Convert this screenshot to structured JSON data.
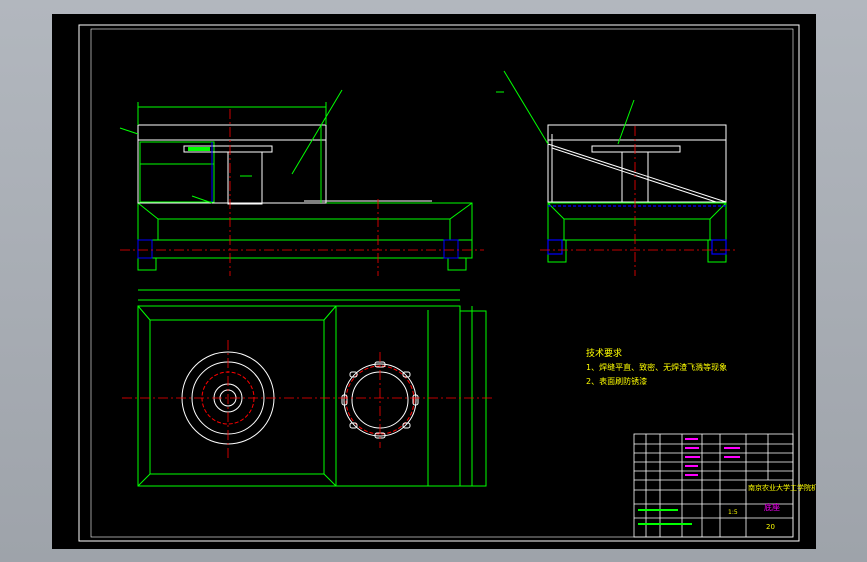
{
  "drawing": {
    "colors": {
      "background": "#000000",
      "frame": "#ffffff",
      "outline": "#00ff00",
      "centerline": "#ff0000",
      "hidden": "#0000ff",
      "note": "#ffff00",
      "title_text": "#ff00ff"
    },
    "tech_requirements": {
      "heading": "技术要求",
      "line1": "1、焊缝平直、致密、无焊渣飞溅等现象",
      "line2": "2、表面刷防锈漆"
    },
    "title_block": {
      "company": "南京农业大学工学院机械",
      "drawing_name": "底座",
      "scale": "1:5",
      "sheet_no": "20"
    }
  }
}
